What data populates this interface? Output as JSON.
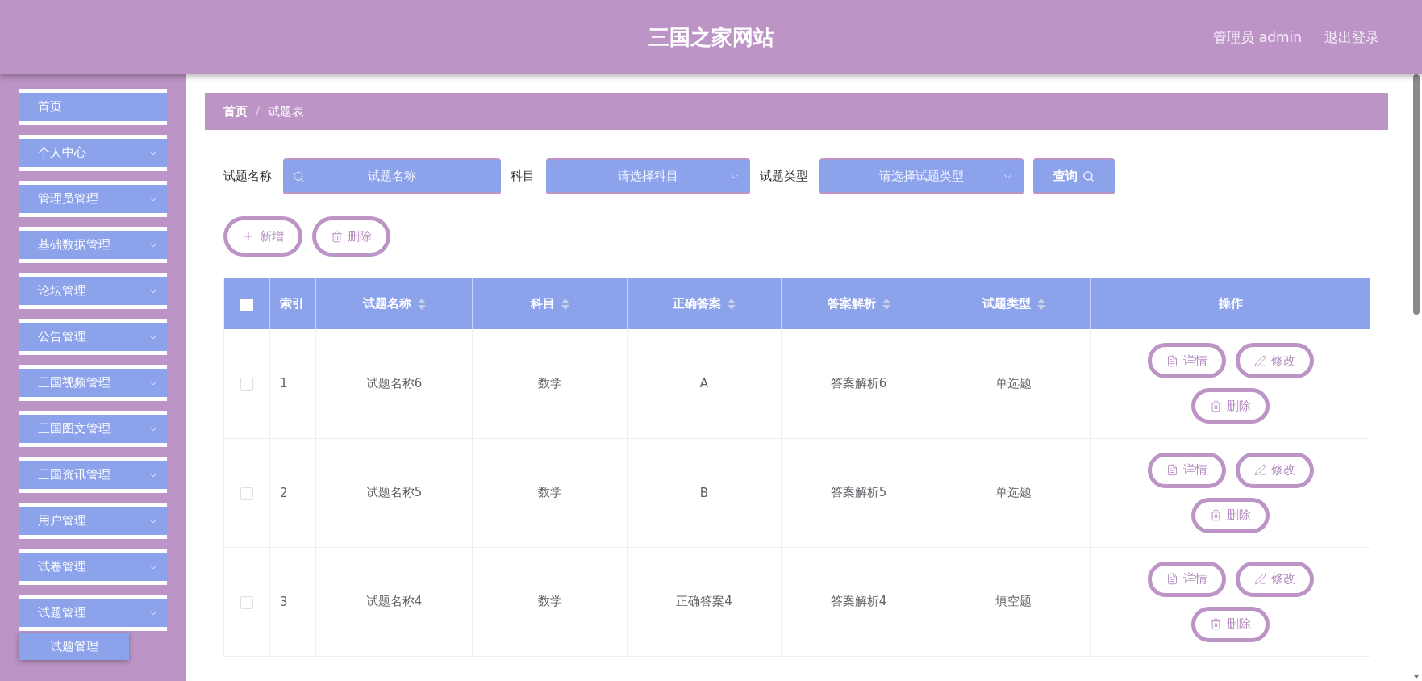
{
  "header": {
    "title": "三国之家网站",
    "user": "管理员 admin",
    "logout": "退出登录"
  },
  "sidebar": {
    "items": [
      {
        "label": "首页",
        "kind": "link"
      },
      {
        "label": "个人中心",
        "kind": "submenu"
      },
      {
        "label": "管理员管理",
        "kind": "submenu"
      },
      {
        "label": "基础数据管理",
        "kind": "submenu"
      },
      {
        "label": "论坛管理",
        "kind": "submenu"
      },
      {
        "label": "公告管理",
        "kind": "submenu"
      },
      {
        "label": "三国视频管理",
        "kind": "submenu"
      },
      {
        "label": "三国图文管理",
        "kind": "submenu"
      },
      {
        "label": "三国资讯管理",
        "kind": "submenu"
      },
      {
        "label": "用户管理",
        "kind": "submenu"
      },
      {
        "label": "试卷管理",
        "kind": "submenu"
      },
      {
        "label": "试题管理",
        "kind": "submenu",
        "children": [
          {
            "label": "试题管理"
          }
        ]
      }
    ]
  },
  "breadcrumb": {
    "items": [
      {
        "label": "首页",
        "kind": "link"
      },
      {
        "label": "试题表",
        "kind": "current"
      }
    ],
    "separator": "/"
  },
  "search": {
    "fields": [
      {
        "kind": "input",
        "label": "试题名称",
        "placeholder": "试题名称"
      },
      {
        "kind": "select",
        "label": "科目",
        "placeholder": "请选择科目"
      },
      {
        "kind": "select",
        "label": "试题类型",
        "placeholder": "请选择试题类型"
      }
    ],
    "button": "查询"
  },
  "actions": [
    {
      "kind": "add",
      "label": "新增"
    },
    {
      "kind": "delete",
      "label": "删除"
    }
  ],
  "table": {
    "select_all": {
      "checked": false
    },
    "columns": [
      {
        "kind": "index",
        "label": "索引",
        "sortable": false
      },
      {
        "kind": "text",
        "label": "试题名称",
        "sortable": true
      },
      {
        "kind": "text",
        "label": "科目",
        "sortable": true
      },
      {
        "kind": "text",
        "label": "正确答案",
        "sortable": true
      },
      {
        "kind": "text",
        "label": "答案解析",
        "sortable": true
      },
      {
        "kind": "text",
        "label": "试题类型",
        "sortable": true
      },
      {
        "kind": "actions",
        "label": "操作",
        "sortable": false
      }
    ],
    "rows": [
      {
        "checked": false,
        "cells": [
          "1",
          "试题名称6",
          "数学",
          "A",
          "答案解析6",
          "单选题"
        ],
        "actions": [
          {
            "kind": "detail",
            "label": "详情"
          },
          {
            "kind": "edit",
            "label": "修改"
          },
          {
            "kind": "delete",
            "label": "删除"
          }
        ]
      },
      {
        "checked": false,
        "cells": [
          "2",
          "试题名称5",
          "数学",
          "B",
          "答案解析5",
          "单选题"
        ],
        "actions": [
          {
            "kind": "detail",
            "label": "详情"
          },
          {
            "kind": "edit",
            "label": "修改"
          },
          {
            "kind": "delete",
            "label": "删除"
          }
        ]
      },
      {
        "checked": false,
        "cells": [
          "3",
          "试题名称4",
          "数学",
          "正确答案4",
          "答案解析4",
          "填空题"
        ],
        "actions": [
          {
            "kind": "detail",
            "label": "详情"
          },
          {
            "kind": "edit",
            "label": "修改"
          },
          {
            "kind": "delete",
            "label": "删除"
          }
        ]
      }
    ]
  }
}
